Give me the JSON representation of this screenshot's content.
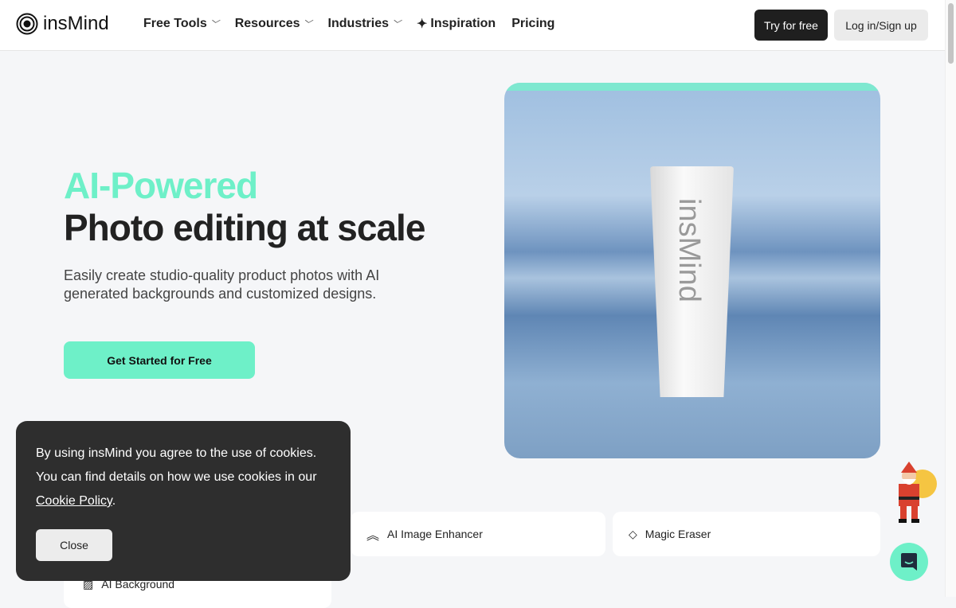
{
  "nav": {
    "brand": "insMind",
    "items": [
      {
        "label": "Free Tools",
        "dropdown": true
      },
      {
        "label": "Resources",
        "dropdown": true
      },
      {
        "label": "Industries",
        "dropdown": true
      },
      {
        "label": "Inspiration",
        "icon": "sparkle-icon"
      },
      {
        "label": "Pricing"
      }
    ],
    "try": "Try for free",
    "login": "Log in/Sign up"
  },
  "hero": {
    "title_accent": "AI-Powered",
    "title": "Photo editing at scale",
    "subtitle": "Easily create studio-quality product photos with AI generated backgrounds and customized designs.",
    "cta": "Get Started for Free",
    "product_text": "insMind",
    "accent": "#6ef0c8"
  },
  "tools": [
    {
      "label": "AI Image Enhancer",
      "icon": "enhance-chevrons-icon"
    },
    {
      "label": "Magic Eraser",
      "icon": "eraser-icon"
    },
    {
      "label": "AI Background",
      "icon": "background-stripes-icon"
    }
  ],
  "cookie": {
    "text1": "By using insMind you agree to the use of cookies. You can find details on how we use cookies in our ",
    "link": "Cookie Policy",
    "text2": ".",
    "close": "Close"
  }
}
